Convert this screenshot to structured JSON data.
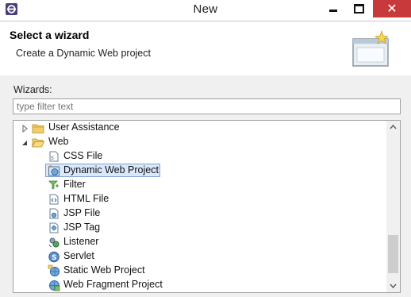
{
  "window": {
    "title": "New"
  },
  "titlebar": {
    "close_glyph": "✕"
  },
  "banner": {
    "title": "Select a wizard",
    "description": "Create a Dynamic Web project",
    "icon": "new-wizard-window-icon"
  },
  "wizards_label": "Wizards:",
  "filter": {
    "placeholder": "type filter text",
    "value": ""
  },
  "tree": {
    "items": [
      {
        "label": "User Assistance",
        "icon": "folder-icon",
        "expanded": false
      },
      {
        "label": "Web",
        "icon": "folder-icon",
        "expanded": true
      },
      {
        "label": "CSS File",
        "icon": "css-file-icon"
      },
      {
        "label": "Dynamic Web Project",
        "icon": "dynamic-web-project-icon",
        "selected": true
      },
      {
        "label": "Filter",
        "icon": "filter-icon"
      },
      {
        "label": "HTML File",
        "icon": "html-file-icon"
      },
      {
        "label": "JSP File",
        "icon": "jsp-file-icon"
      },
      {
        "label": "JSP Tag",
        "icon": "jsp-tag-icon"
      },
      {
        "label": "Listener",
        "icon": "listener-icon"
      },
      {
        "label": "Servlet",
        "icon": "servlet-icon"
      },
      {
        "label": "Static Web Project",
        "icon": "static-web-project-icon"
      },
      {
        "label": "Web Fragment Project",
        "icon": "web-fragment-project-icon"
      }
    ]
  },
  "colors": {
    "close_button": "#c7393a",
    "selection": "#d9e8fb",
    "selection_border": "#7da2ce",
    "folder": "#e8c15a"
  }
}
